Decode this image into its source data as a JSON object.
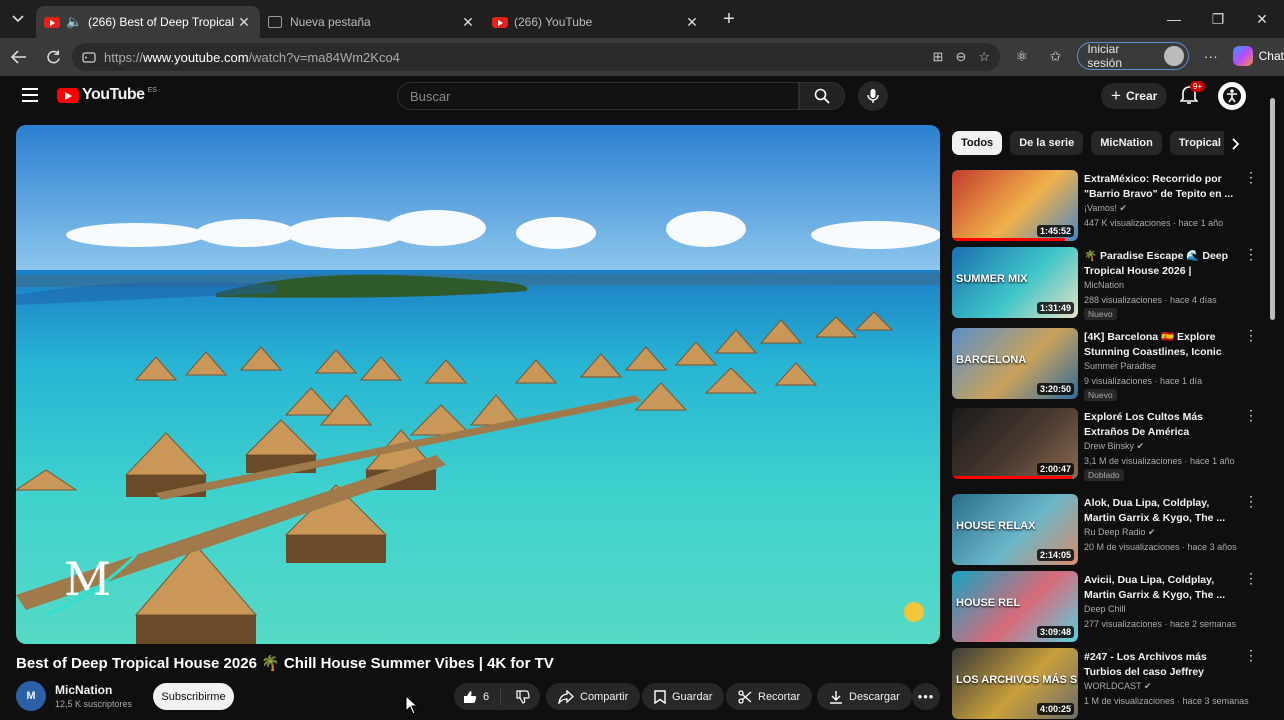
{
  "browser": {
    "tabs": [
      {
        "title": "(266) Best of Deep Tropical Ho",
        "active": true,
        "audio": true
      },
      {
        "title": "Nueva pestaña",
        "active": false
      },
      {
        "title": "(266) YouTube",
        "active": false
      }
    ],
    "url_prefix": "https://",
    "url_domain": "www.youtube.com",
    "url_path": "/watch?v=ma84Wm2Kco4",
    "signin_label": "Iniciar sesión",
    "chat_label": "Chat"
  },
  "header": {
    "logo_text": "YouTube",
    "logo_country": "ES",
    "search_placeholder": "Buscar",
    "create_label": "Crear",
    "notifications_badge": "9+"
  },
  "video": {
    "title": "Best of Deep Tropical House 2026 🌴 Chill House Summer Vibes | 4K for TV",
    "channel_name": "MicNation",
    "channel_subs": "12,5 K suscriptores",
    "channel_avatar_text": "M",
    "subscribe_label": "Subscribirme",
    "likes": "6",
    "share_label": "Compartir",
    "save_label": "Guardar",
    "clip_label": "Recortar",
    "download_label": "Descargar"
  },
  "chips": [
    "Todos",
    "De la serie",
    "MicNation",
    "Tropical ho"
  ],
  "recommendations": [
    {
      "title": "ExtraMéxico: Recorrido por \"Barrio Bravo\" de Tepito en ...",
      "channel": "¡Vamos! ✔",
      "meta": "447 K visualizaciones · hace 1 año",
      "duration": "1:45:52",
      "tag": "",
      "colors": [
        "#c43b2e",
        "#f0b24a",
        "#4a86c7"
      ]
    },
    {
      "title": "🌴 Paradise Escape 🌊 Deep Tropical House 2026 | Relaxin...",
      "channel": "MicNation",
      "meta": "288 visualizaciones · hace 4 días",
      "duration": "1:31:49",
      "tag": "Nuevo",
      "colors": [
        "#1c6fb0",
        "#3ec6c9",
        "#e9e1c5"
      ]
    },
    {
      "title": "[4K] Barcelona 🇪🇸 Explore Stunning Coastlines, Iconic Cit...",
      "channel": "Summer Paradise",
      "meta": "9 visualizaciones · hace 1 día",
      "duration": "3:20:50",
      "tag": "Nuevo",
      "colors": [
        "#5a8fc9",
        "#c9a25a",
        "#2f6b9c"
      ]
    },
    {
      "title": "Exploré Los Cultos Más Extraños De América",
      "channel": "Drew Binsky ✔",
      "meta": "3,1 M de visualizaciones · hace 1 año",
      "duration": "2:00:47",
      "tag": "Doblado",
      "colors": [
        "#1a1a1a",
        "#4a3a30",
        "#8a6a50"
      ]
    },
    {
      "title": "Alok, Dua Lipa, Coldplay, Martin Garrix & Kygo, The ...",
      "channel": "Ru Deep Radio ✔",
      "meta": "20 M de visualizaciones · hace 3 años",
      "duration": "2:14:05",
      "tag": "",
      "colors": [
        "#2a6f8a",
        "#6ab6c9",
        "#d98c6a"
      ]
    },
    {
      "title": "Avicii, Dua Lipa, Coldplay, Martin Garrix & Kygo, The ...",
      "channel": "Deep Chill",
      "meta": "277 visualizaciones · hace 2 semanas",
      "duration": "3:09:48",
      "tag": "",
      "colors": [
        "#16a3c4",
        "#d96a7a",
        "#57d1e0"
      ]
    },
    {
      "title": "#247 - Los Archivos más Turbios del caso Jeffrey Epstein",
      "channel": "WORLDCAST ✔",
      "meta": "1 M de visualizaciones · hace 3 semanas",
      "duration": "4:00:25",
      "tag": "",
      "colors": [
        "#3a3a3a",
        "#c9a03a",
        "#6a6a6a"
      ]
    }
  ],
  "thumb_labels": [
    "",
    "SUMMER MIX",
    "BARCELONA",
    "",
    "HOUSE  RELAX",
    "HOUSE REL",
    "LOS ARCHIVOS MÁS SECRETOS · JEFFREY EPST"
  ]
}
